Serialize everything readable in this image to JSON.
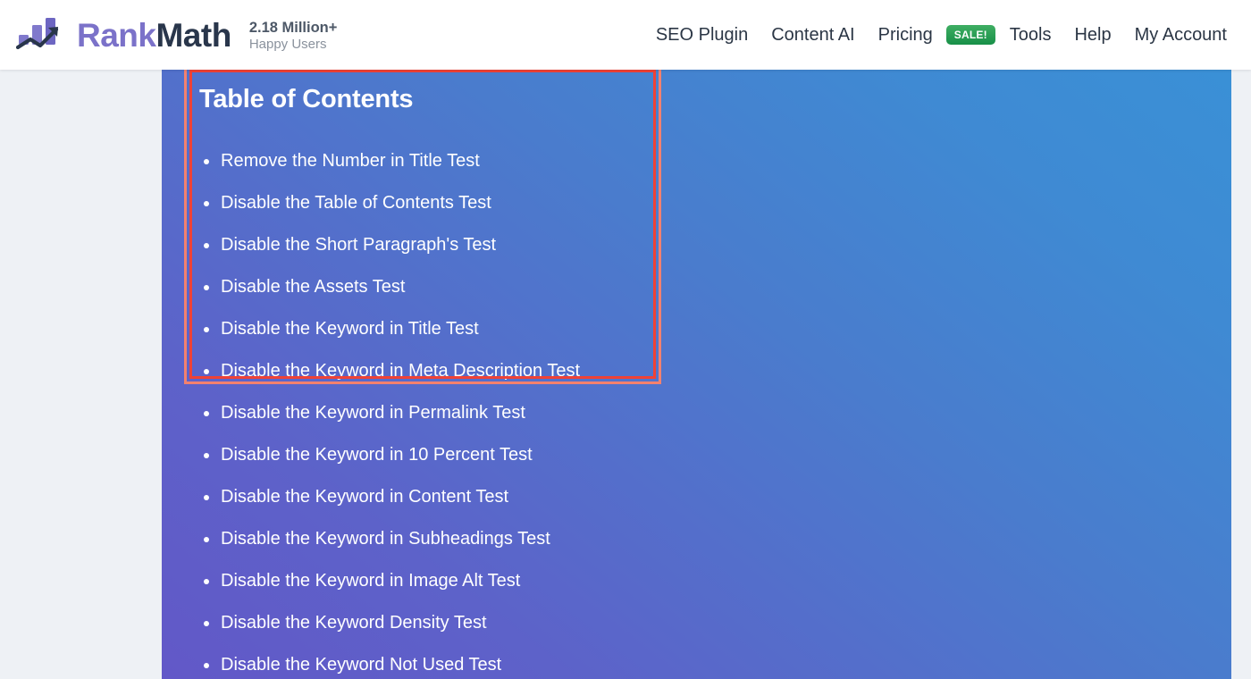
{
  "header": {
    "logo_icon": "rankmath-bar-chart-arrow-logo",
    "brand_rank": "Rank",
    "brand_math": "Math",
    "users_count": "2.18 Million+",
    "users_label": "Happy Users",
    "nav": [
      {
        "label": "SEO Plugin",
        "name": "nav-seo-plugin"
      },
      {
        "label": "Content AI",
        "name": "nav-content-ai"
      },
      {
        "label": "Pricing",
        "name": "nav-pricing"
      },
      {
        "label": "Tools",
        "name": "nav-tools"
      },
      {
        "label": "Help",
        "name": "nav-help"
      },
      {
        "label": "My Account",
        "name": "nav-my-account"
      }
    ],
    "sale_badge": "SALE!"
  },
  "toc": {
    "title": "Table of Contents",
    "items": [
      "Remove the Number in Title Test",
      "Disable the Table of Contents Test",
      "Disable the Short Paragraph's Test",
      "Disable the Assets Test",
      "Disable the Keyword in Title Test",
      "Disable the Keyword in Meta Description Test",
      "Disable the Keyword in Permalink Test",
      "Disable the Keyword in 10 Percent Test",
      "Disable the Keyword in Content Test",
      "Disable the Keyword in Subheadings Test",
      "Disable the Keyword in Image Alt Test",
      "Disable the Keyword Density Test",
      "Disable the Keyword Not Used Test"
    ]
  },
  "colors": {
    "brand_purple": "#7b72c9",
    "brand_navy": "#29364b",
    "gradient_start": "#6258c8",
    "gradient_end": "#3a90d6",
    "sale_green": "#189048",
    "highlight_red": "#ef4236",
    "highlight_red_outer": "#f4816e",
    "page_margin": "#eef1f5"
  }
}
